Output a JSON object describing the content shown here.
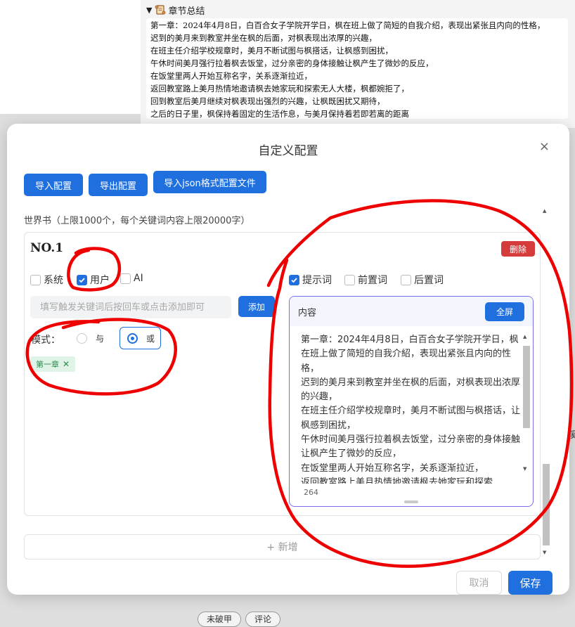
{
  "background": {
    "summary_title": "章节总结",
    "summary_lines": [
      "第一章：2024年4月8日，白百合女子学院开学日，枫在班上做了简短的自我介绍，表现出紧张且内向的性格，",
      "迟到的美月来到教室并坐在枫的后面，对枫表现出浓厚的兴趣，",
      "在班主任介绍学校规章时，美月不断试图与枫搭话，让枫感到困扰，",
      "午休时间美月强行拉着枫去饭堂，过分亲密的身体接触让枫产生了微妙的反应，",
      "在饭堂里两人开始互称名字，关系逐渐拉近，",
      "返回教室路上美月热情地邀请枫去她家玩和探索无人大楼，枫都婉拒了，",
      "回到教室后美月继续对枫表现出强烈的兴趣，让枫既困扰又期待，",
      "之后的日子里，枫保持着固定的生活作息，与美月保持着若即若离的距离"
    ],
    "right_edge_text": "溪",
    "bottom_buttons": [
      "未破甲",
      "评论"
    ]
  },
  "modal": {
    "title": "自定义配置",
    "close_label": "×",
    "import_config": "导入配置",
    "export_config": "导出配置",
    "import_json": "导入json格式配置文件",
    "worldbook_label": "世界书（上限1000个，每个关键词内容上限20000字）",
    "entry": {
      "number": "NO.1",
      "delete_label": "删除",
      "role_checks": [
        {
          "label": "系统",
          "checked": false
        },
        {
          "label": "用户",
          "checked": true
        },
        {
          "label": "AI",
          "checked": false
        }
      ],
      "position_checks": [
        {
          "label": "提示词",
          "checked": true
        },
        {
          "label": "前置词",
          "checked": false
        },
        {
          "label": "后置词",
          "checked": false
        }
      ],
      "keyword_placeholder": "填写触发关键词后按回车或点击添加即可",
      "add_label": "添加",
      "mode_label": "模式：",
      "mode_and": "与",
      "mode_or": "或",
      "mode_selected": "或",
      "tags": [
        "第一章"
      ],
      "content_label": "内容",
      "fullscreen_label": "全屏",
      "content_text": "第一章：2024年4月8日，白百合女子学院开学日，枫在班上做了简短的自我介紹，表现出紧张且内向的性格，\n迟到的美月来到教室并坐在枫的后面，对枫表现出浓厚的兴趣，\n在班主任介绍学校规章时，美月不断试图与枫搭话，让枫感到困扰，\n午休时间美月强行拉着枫去饭堂，过分亲密的身体接触让枫产生了微妙的反应，\n在饭堂里两人开始互称名字，关系逐渐拉近，\n返回教室路上美月热情地邀请枫去她家玩和探索",
      "char_count": "264"
    },
    "add_entry_label": "+ 新增",
    "cancel_label": "取消",
    "save_label": "保存"
  },
  "colors": {
    "primary": "#1f6fde",
    "danger": "#d63b3b",
    "tag_bg": "#dff3e6",
    "tag_text": "#2f8b4f",
    "annotation": "#ee0000"
  }
}
